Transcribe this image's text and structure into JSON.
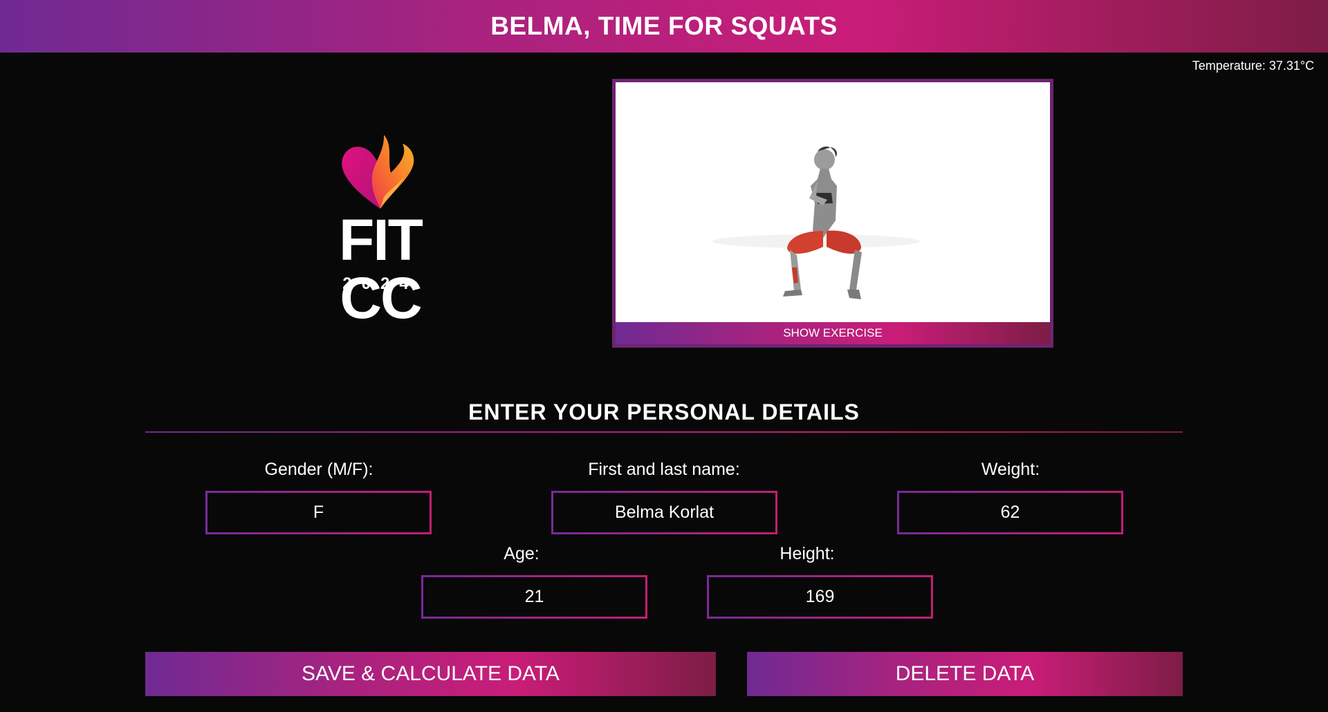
{
  "header": {
    "title": "BELMA, TIME FOR SQUATS"
  },
  "status": {
    "temperature": "Temperature: 37.31°C"
  },
  "logo": {
    "text": "FIT CC",
    "year": "2024"
  },
  "exercise": {
    "show_label": "SHOW EXERCISE",
    "image_icon": "squat-exercise-illustration"
  },
  "form": {
    "title": "ENTER YOUR PERSONAL DETAILS",
    "gender": {
      "label": "Gender (M/F):",
      "value": "F"
    },
    "name": {
      "label": "First and last name:",
      "value": "Belma Korlat"
    },
    "weight": {
      "label": "Weight:",
      "value": "62"
    },
    "age": {
      "label": "Age:",
      "value": "21"
    },
    "height": {
      "label": "Height:",
      "value": "169"
    }
  },
  "buttons": {
    "save_label": "SAVE & CALCULATE DATA",
    "delete_label": "DELETE DATA"
  },
  "colors": {
    "gradient_start": "#6f2a93",
    "gradient_mid": "#c91d78",
    "gradient_end": "#7d1d45",
    "background": "#080808"
  }
}
